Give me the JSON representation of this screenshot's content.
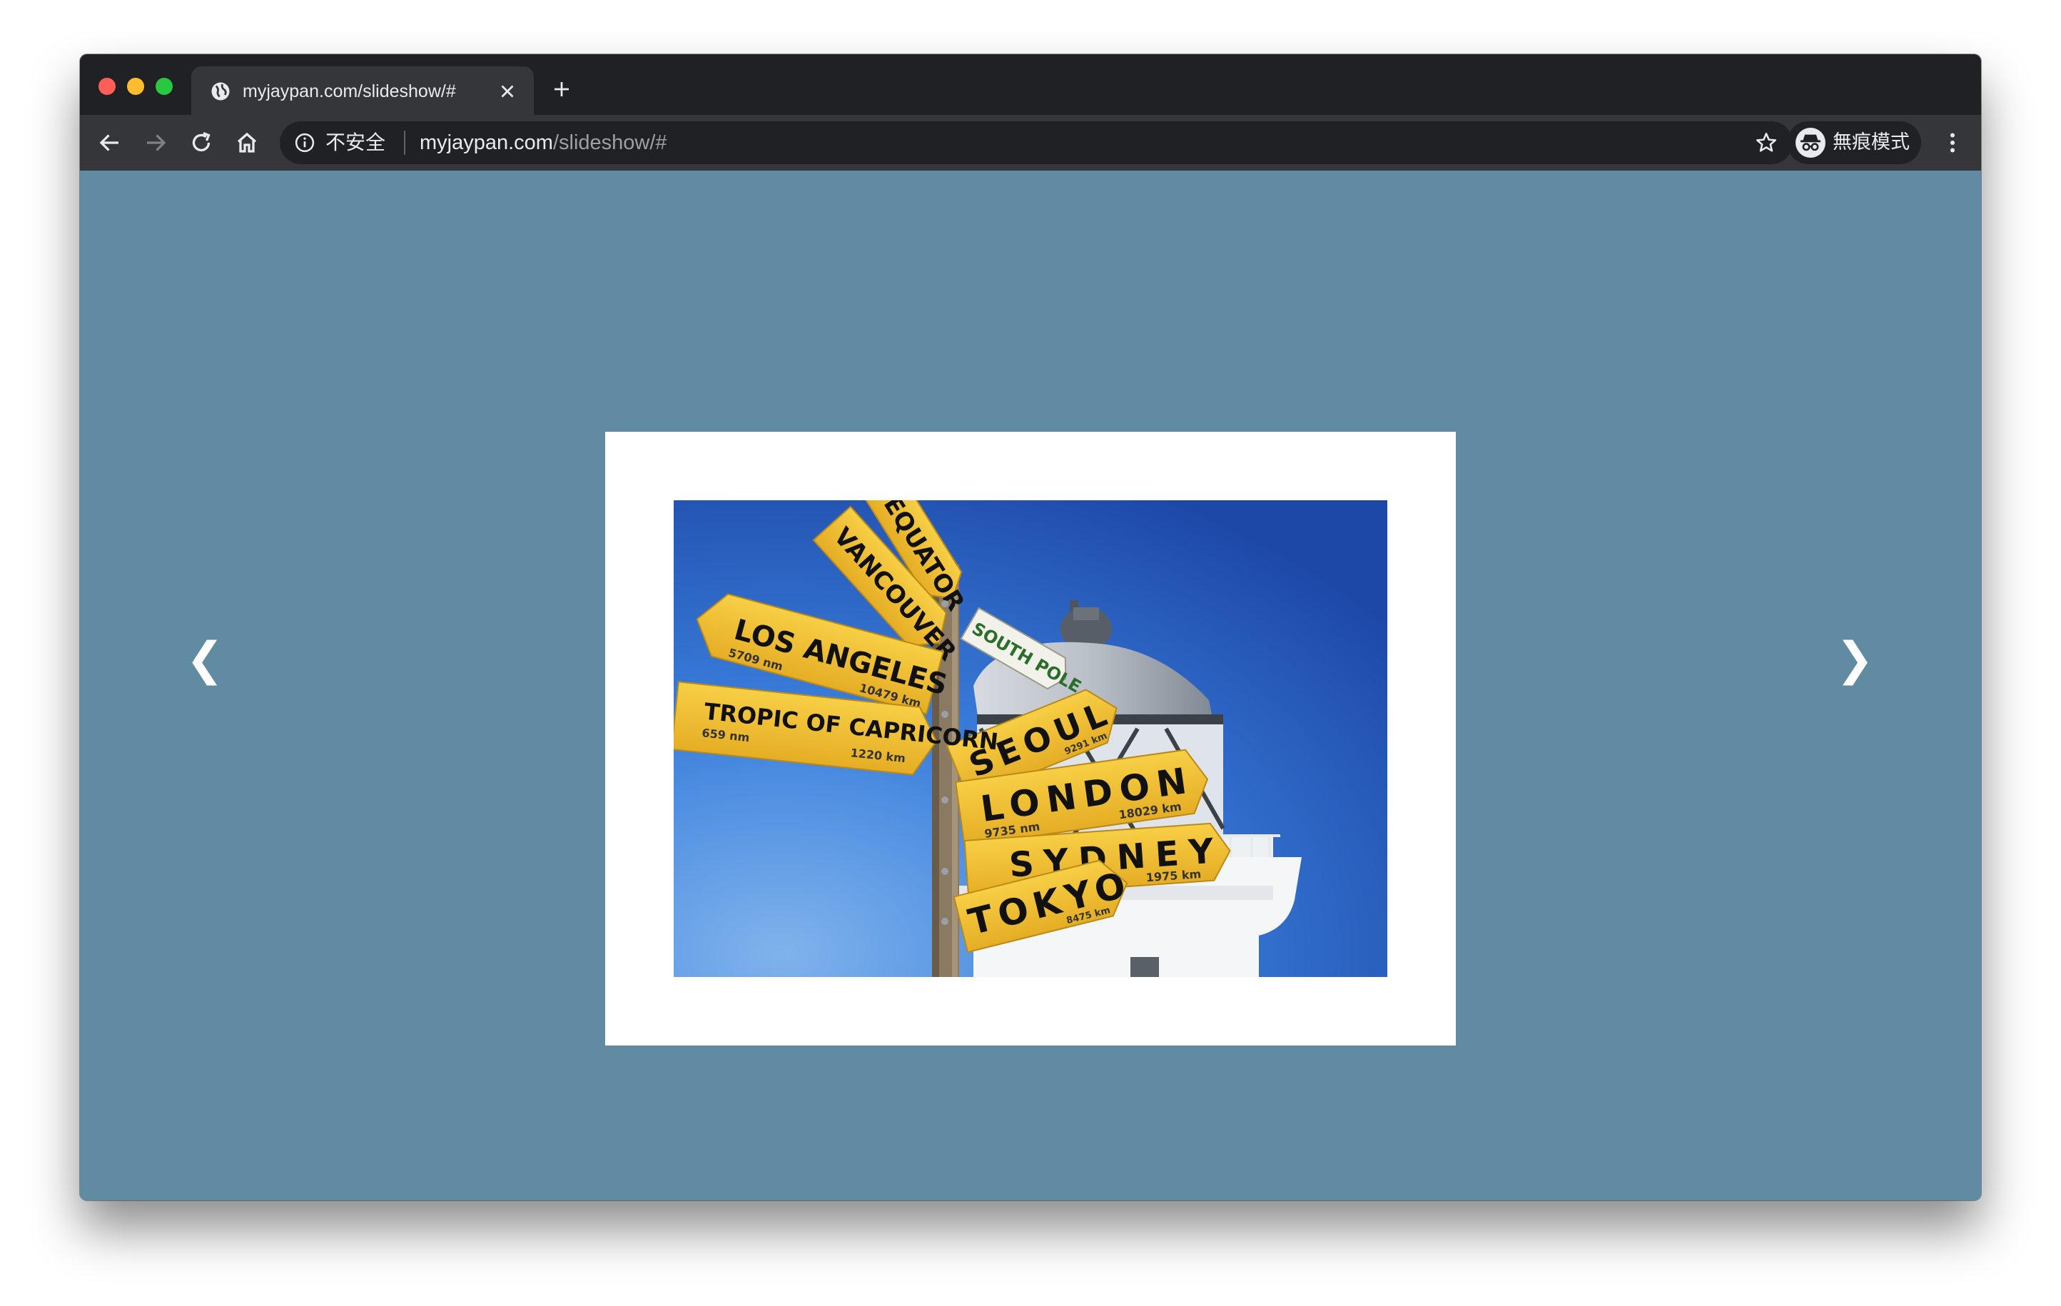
{
  "browser": {
    "tab": {
      "title": "myjaypan.com/slideshow/#",
      "favicon": "globe-icon"
    },
    "omnibox": {
      "security_label": "不安全",
      "url_host": "myjaypan.com",
      "url_path": "/slideshow/#"
    },
    "profile": {
      "label": "無痕模式",
      "icon": "incognito-icon"
    }
  },
  "slideshow": {
    "prev_label": "❮",
    "next_label": "❯",
    "slide": {
      "description": "signpost",
      "signs": [
        "EQUATOR",
        "VANCOUVER",
        "SOUTH POLE",
        "LOS ANGELES",
        "SEOUL",
        "TROPIC OF CAPRICORN",
        "LONDON",
        "SYDNEY",
        "TOKYO"
      ],
      "distances": [
        "5709 nm",
        "10479 km",
        "659 nm",
        "1220 km",
        "9735 nm",
        "18029 km",
        "1975 km",
        "8475 km",
        "9291 km"
      ]
    }
  },
  "colors": {
    "page_background": "#618aa3",
    "tabstrip": "#202124",
    "toolbar": "#35363a",
    "sign_yellow": "#f3c33a",
    "sky_blue": "#2f6fd3"
  }
}
